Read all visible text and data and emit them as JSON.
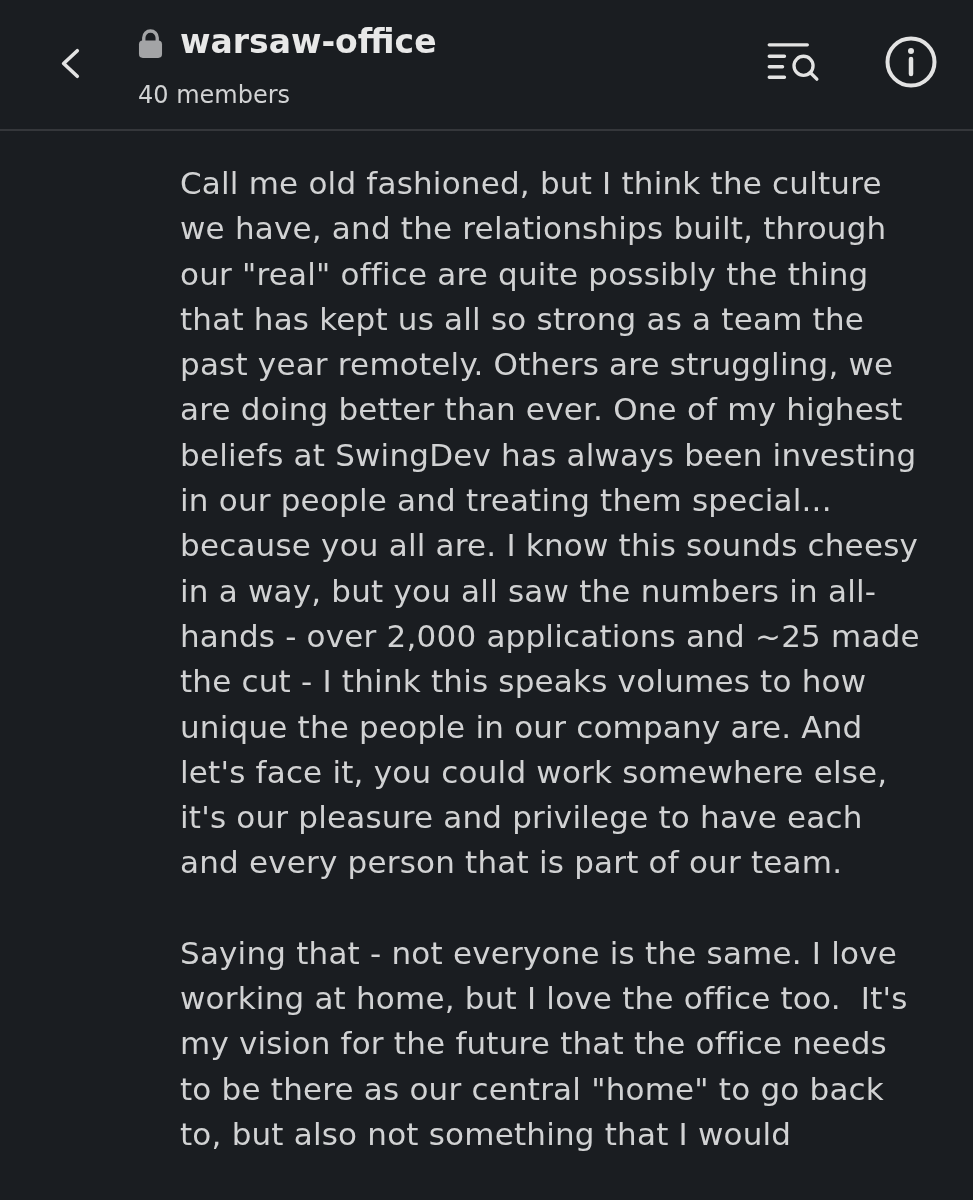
{
  "header": {
    "channel": {
      "name": "warsaw-office",
      "private": true
    },
    "member_count": "40 members"
  },
  "message": {
    "paragraphs": [
      "Call me old fashioned, but I think the culture we have, and the relationships built, through our \"real\" office are quite possibly the thing that has kept us all so strong as a team the past year remotely. Others are struggling, we are doing better than ever. One of my highest beliefs at SwingDev has always been investing in our people and treating them special... because you all are. I know this sounds cheesy in a way, but you all saw the numbers in all-hands - over 2,000 applications and ~25 made the cut - I think this speaks volumes to how unique the people in our company are. And let's face it, you could work somewhere else, it's our pleasure and privilege to have each and every person that is part of our team.",
      "Saying that - not everyone is the same. I love working at home, but I love the office too.  It's my vision for the future that the office needs to be there as our central \"home\" to go back to, but also not something that I would"
    ]
  }
}
